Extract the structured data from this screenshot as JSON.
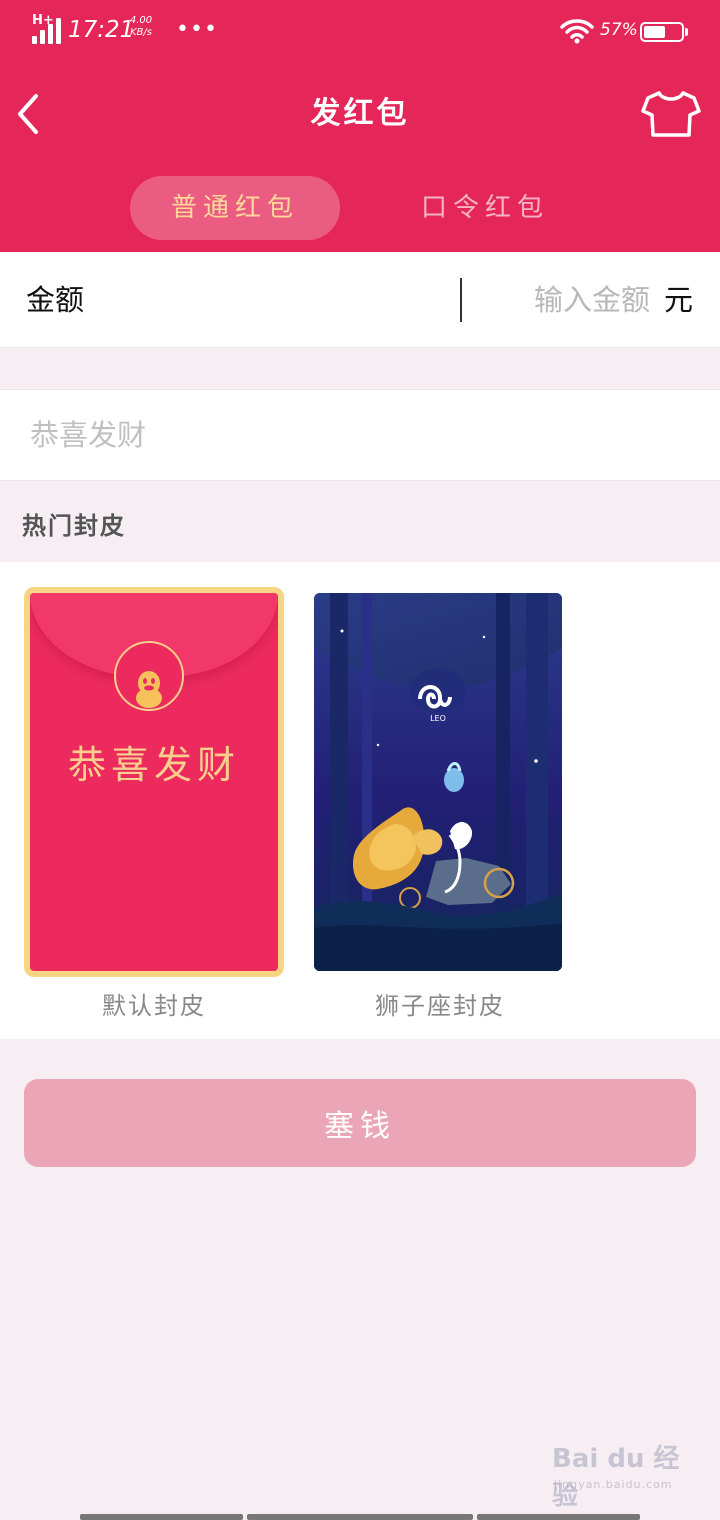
{
  "status_bar": {
    "network": "H+",
    "time": "17:21",
    "speed_value": "4.00",
    "speed_unit": "KB/s",
    "more": "•••",
    "battery_percent": "57%",
    "battery_level": 0.57
  },
  "header": {
    "title": "发红包",
    "background_color": "#e52659"
  },
  "tabs": [
    {
      "label": "普通红包",
      "active": true
    },
    {
      "label": "口令红包",
      "active": false
    }
  ],
  "amount": {
    "label": "金额",
    "placeholder": "输入金额",
    "unit": "元"
  },
  "wish": {
    "placeholder": "恭喜发财"
  },
  "covers_section": {
    "title": "热门封皮",
    "items": [
      {
        "name": "默认封皮",
        "greeting": "恭喜发财",
        "selected": true
      },
      {
        "name": "狮子座封皮",
        "badge": "LEO",
        "selected": false
      }
    ]
  },
  "submit": {
    "label": "塞钱"
  },
  "watermark": {
    "logo": "Bai du 经验",
    "url": "jingyan.baidu.com"
  },
  "icons": [
    "signal-icon",
    "wifi-icon",
    "battery-icon",
    "back-arrow-icon",
    "shirt-icon",
    "penguin-icon",
    "leo-symbol-icon"
  ]
}
